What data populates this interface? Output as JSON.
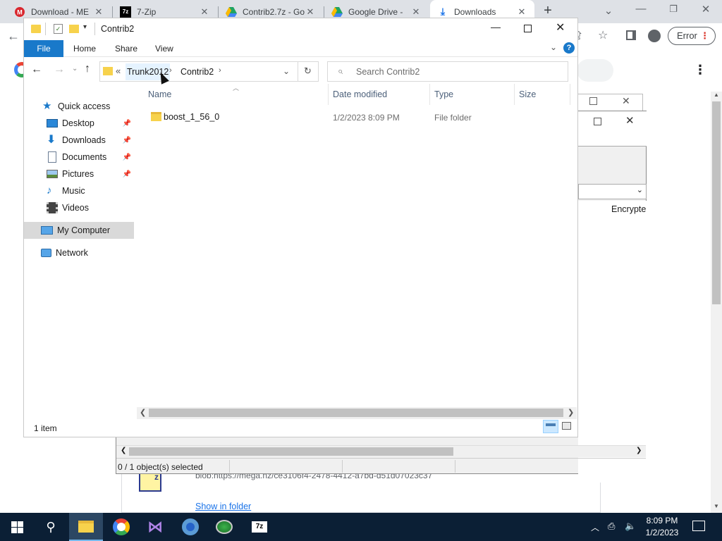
{
  "chrome": {
    "tabs": [
      {
        "title": "Download - ME",
        "icon": "mega-icon",
        "color": "#d9272e"
      },
      {
        "title": "7-Zip",
        "icon": "7zip-icon",
        "color": "#000000"
      },
      {
        "title": "Contrib2.7z - Go",
        "icon": "google-drive-icon",
        "color": "#1fa463"
      },
      {
        "title": "Google Drive - ",
        "icon": "google-drive-icon",
        "color": "#1fa463"
      },
      {
        "title": "Downloads",
        "icon": "download-icon",
        "color": "#1a73e8",
        "active": true
      }
    ],
    "new_tab": "+",
    "profile_label": "Error"
  },
  "background_dialog": {
    "column": "Encrypte",
    "status": "0 / 1 object(s) selected"
  },
  "download_item": {
    "url": "blob:https://mega.nz/ce3106f4-2478-4412-a7bd-d51d07023c37",
    "show_in_folder": "Show in folder"
  },
  "explorer": {
    "title": "Contrib2",
    "ribbon_tabs": [
      "File",
      "Home",
      "Share",
      "View"
    ],
    "address": {
      "prefix": "«",
      "crumbs": [
        "Trunk2012",
        "Contrib2"
      ]
    },
    "search_placeholder": "Search Contrib2",
    "nav": [
      {
        "label": "Quick access",
        "icon": "star-icon",
        "indent": 0
      },
      {
        "label": "Desktop",
        "icon": "desktop-icon",
        "indent": 1,
        "pinned": true
      },
      {
        "label": "Downloads",
        "icon": "download-arrow-icon",
        "indent": 1,
        "pinned": true
      },
      {
        "label": "Documents",
        "icon": "documents-icon",
        "indent": 1,
        "pinned": true
      },
      {
        "label": "Pictures",
        "icon": "pictures-icon",
        "indent": 1,
        "pinned": true
      },
      {
        "label": "Music",
        "icon": "music-icon",
        "indent": 1
      },
      {
        "label": "Videos",
        "icon": "videos-icon",
        "indent": 1
      },
      {
        "label": "My Computer",
        "icon": "computer-icon",
        "indent": 0,
        "selected": true
      },
      {
        "label": "Network",
        "icon": "network-icon",
        "indent": 0
      }
    ],
    "columns": [
      "Name",
      "Date modified",
      "Type",
      "Size"
    ],
    "rows": [
      {
        "name": "boost_1_56_0",
        "date": "1/2/2023 8:09 PM",
        "type": "File folder",
        "size": ""
      }
    ],
    "status": "1 item"
  },
  "taskbar": {
    "time": "8:09 PM",
    "date": "1/2/2023"
  }
}
